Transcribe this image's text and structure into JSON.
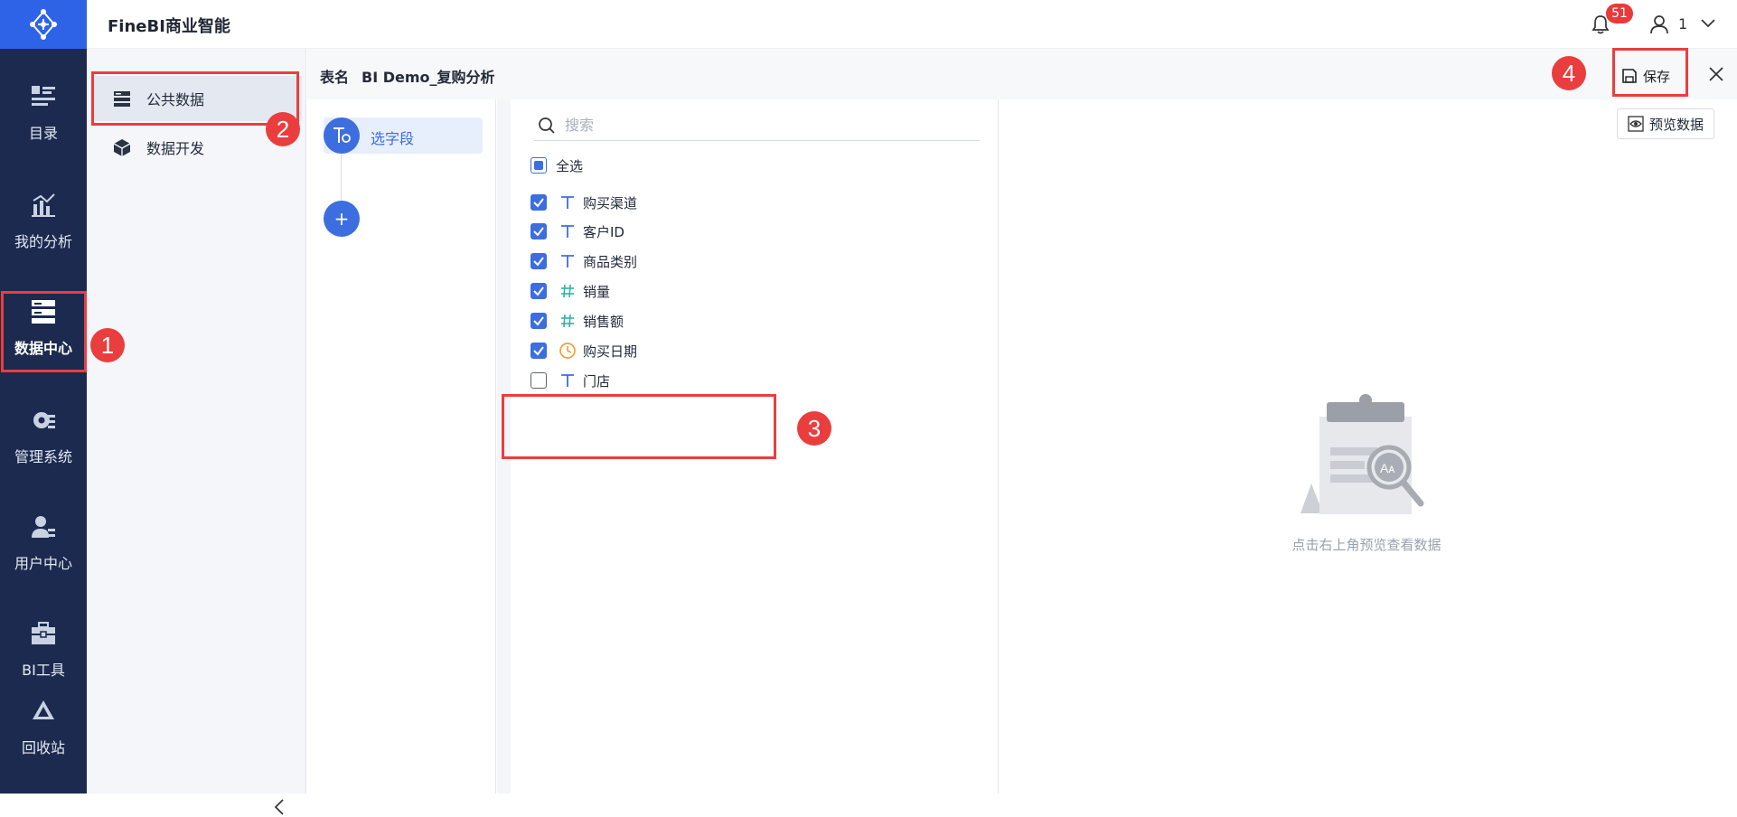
{
  "app": {
    "title": "FineBI商业智能"
  },
  "header": {
    "notification_count": "51",
    "user_name": "1"
  },
  "rail": {
    "items": [
      {
        "label": "目录",
        "icon": "catalog-icon"
      },
      {
        "label": "我的分析",
        "icon": "analysis-icon"
      },
      {
        "label": "数据中心",
        "icon": "data-center-icon",
        "active": true
      },
      {
        "label": "管理系统",
        "icon": "management-gear-icon"
      },
      {
        "label": "用户中心",
        "icon": "user-center-icon"
      },
      {
        "label": "BI工具",
        "icon": "toolbox-icon"
      },
      {
        "label": "回收站",
        "icon": "recycle-bin-icon"
      }
    ]
  },
  "panel2": {
    "items": [
      {
        "label": "公共数据",
        "icon": "database-icon",
        "active": true
      },
      {
        "label": "数据开发",
        "icon": "cube-icon"
      }
    ]
  },
  "editor": {
    "table_label": "表名",
    "table_name": "BI Demo_复购分析",
    "save_label": "保存",
    "step_label": "选字段",
    "add_step": "+",
    "search_placeholder": "搜索",
    "select_all_label": "全选",
    "fields": [
      {
        "name": "购买渠道",
        "type": "text",
        "checked": true
      },
      {
        "name": "客户ID",
        "type": "text",
        "checked": true
      },
      {
        "name": "商品类别",
        "type": "text",
        "checked": true
      },
      {
        "name": "销量",
        "type": "number",
        "checked": true
      },
      {
        "name": "销售额",
        "type": "number",
        "checked": true
      },
      {
        "name": "购买日期",
        "type": "date",
        "checked": true
      },
      {
        "name": "门店",
        "type": "text",
        "checked": false
      }
    ],
    "preview_button": "预览数据",
    "empty_hint": "点击右上角预览查看数据"
  },
  "annotations": {
    "m1": "1",
    "m2": "2",
    "m3": "3",
    "m4": "4"
  },
  "colors": {
    "rail_bg": "#1B2A4E",
    "accent": "#3C6EE0",
    "annotation_red": "#EA3E3E"
  }
}
